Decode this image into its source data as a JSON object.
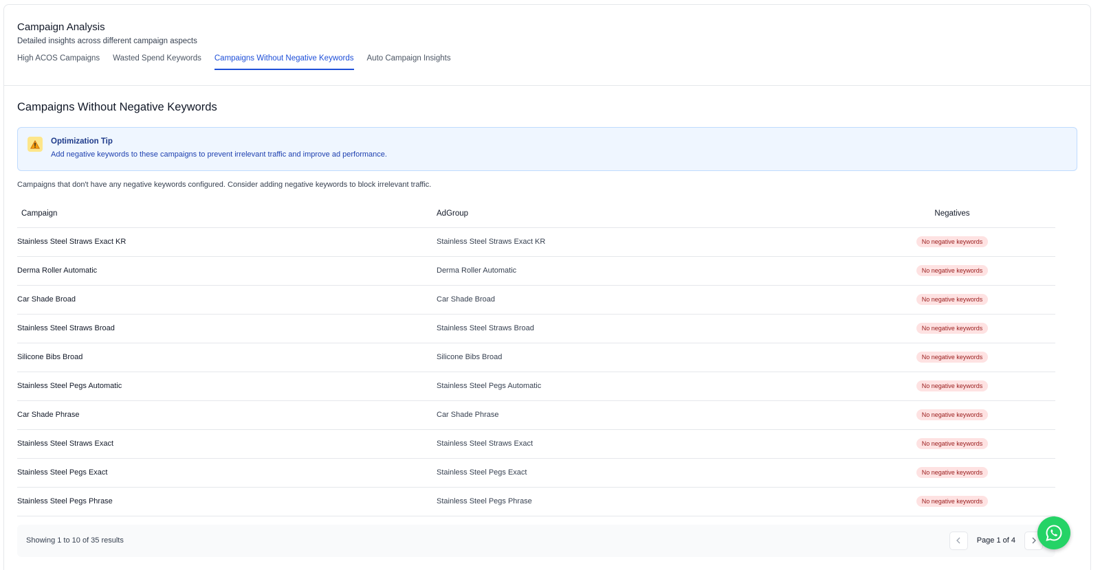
{
  "header": {
    "title": "Campaign Analysis",
    "subtitle": "Detailed insights across different campaign aspects",
    "tabs": [
      {
        "label": "High ACOS Campaigns",
        "active": false
      },
      {
        "label": "Wasted Spend Keywords",
        "active": false
      },
      {
        "label": "Campaigns Without Negative Keywords",
        "active": true
      },
      {
        "label": "Auto Campaign Insights",
        "active": false
      }
    ]
  },
  "section": {
    "title": "Campaigns Without Negative Keywords",
    "tip": {
      "icon": "warning-icon",
      "title": "Optimization Tip",
      "text": "Add negative keywords to these campaigns to prevent irrelevant traffic and improve ad performance."
    },
    "description": "Campaigns that don't have any negative keywords configured. Consider adding negative keywords to block irrelevant traffic."
  },
  "table": {
    "columns": [
      "Campaign",
      "AdGroup",
      "Negatives"
    ],
    "rows": [
      {
        "campaign": "Stainless Steel Straws Exact KR",
        "adgroup": "Stainless Steel Straws Exact KR",
        "negatives": "No negative keywords"
      },
      {
        "campaign": "Derma Roller Automatic",
        "adgroup": "Derma Roller Automatic",
        "negatives": "No negative keywords"
      },
      {
        "campaign": "Car Shade Broad",
        "adgroup": "Car Shade Broad",
        "negatives": "No negative keywords"
      },
      {
        "campaign": "Stainless Steel Straws Broad",
        "adgroup": "Stainless Steel Straws Broad",
        "negatives": "No negative keywords"
      },
      {
        "campaign": "Silicone Bibs Broad",
        "adgroup": "Silicone Bibs Broad",
        "negatives": "No negative keywords"
      },
      {
        "campaign": "Stainless Steel Pegs Automatic",
        "adgroup": "Stainless Steel Pegs Automatic",
        "negatives": "No negative keywords"
      },
      {
        "campaign": "Car Shade Phrase",
        "adgroup": "Car Shade Phrase",
        "negatives": "No negative keywords"
      },
      {
        "campaign": "Stainless Steel Straws Exact",
        "adgroup": "Stainless Steel Straws Exact",
        "negatives": "No negative keywords"
      },
      {
        "campaign": "Stainless Steel Pegs Exact",
        "adgroup": "Stainless Steel Pegs Exact",
        "negatives": "No negative keywords"
      },
      {
        "campaign": "Stainless Steel Pegs Phrase",
        "adgroup": "Stainless Steel Pegs Phrase",
        "negatives": "No negative keywords"
      }
    ]
  },
  "footer": {
    "summary": "Showing 1 to 10 of 35 results",
    "page_label": "Page 1 of 4",
    "prev_icon": "chevron-left-icon",
    "next_icon": "chevron-right-icon"
  },
  "fab": {
    "icon": "whatsapp-icon"
  },
  "colors": {
    "accent": "#1d4ed8",
    "badge_bg": "#fee2e2",
    "badge_text": "#991b1b",
    "tip_bg": "#eff6ff",
    "whatsapp": "#25d366"
  }
}
